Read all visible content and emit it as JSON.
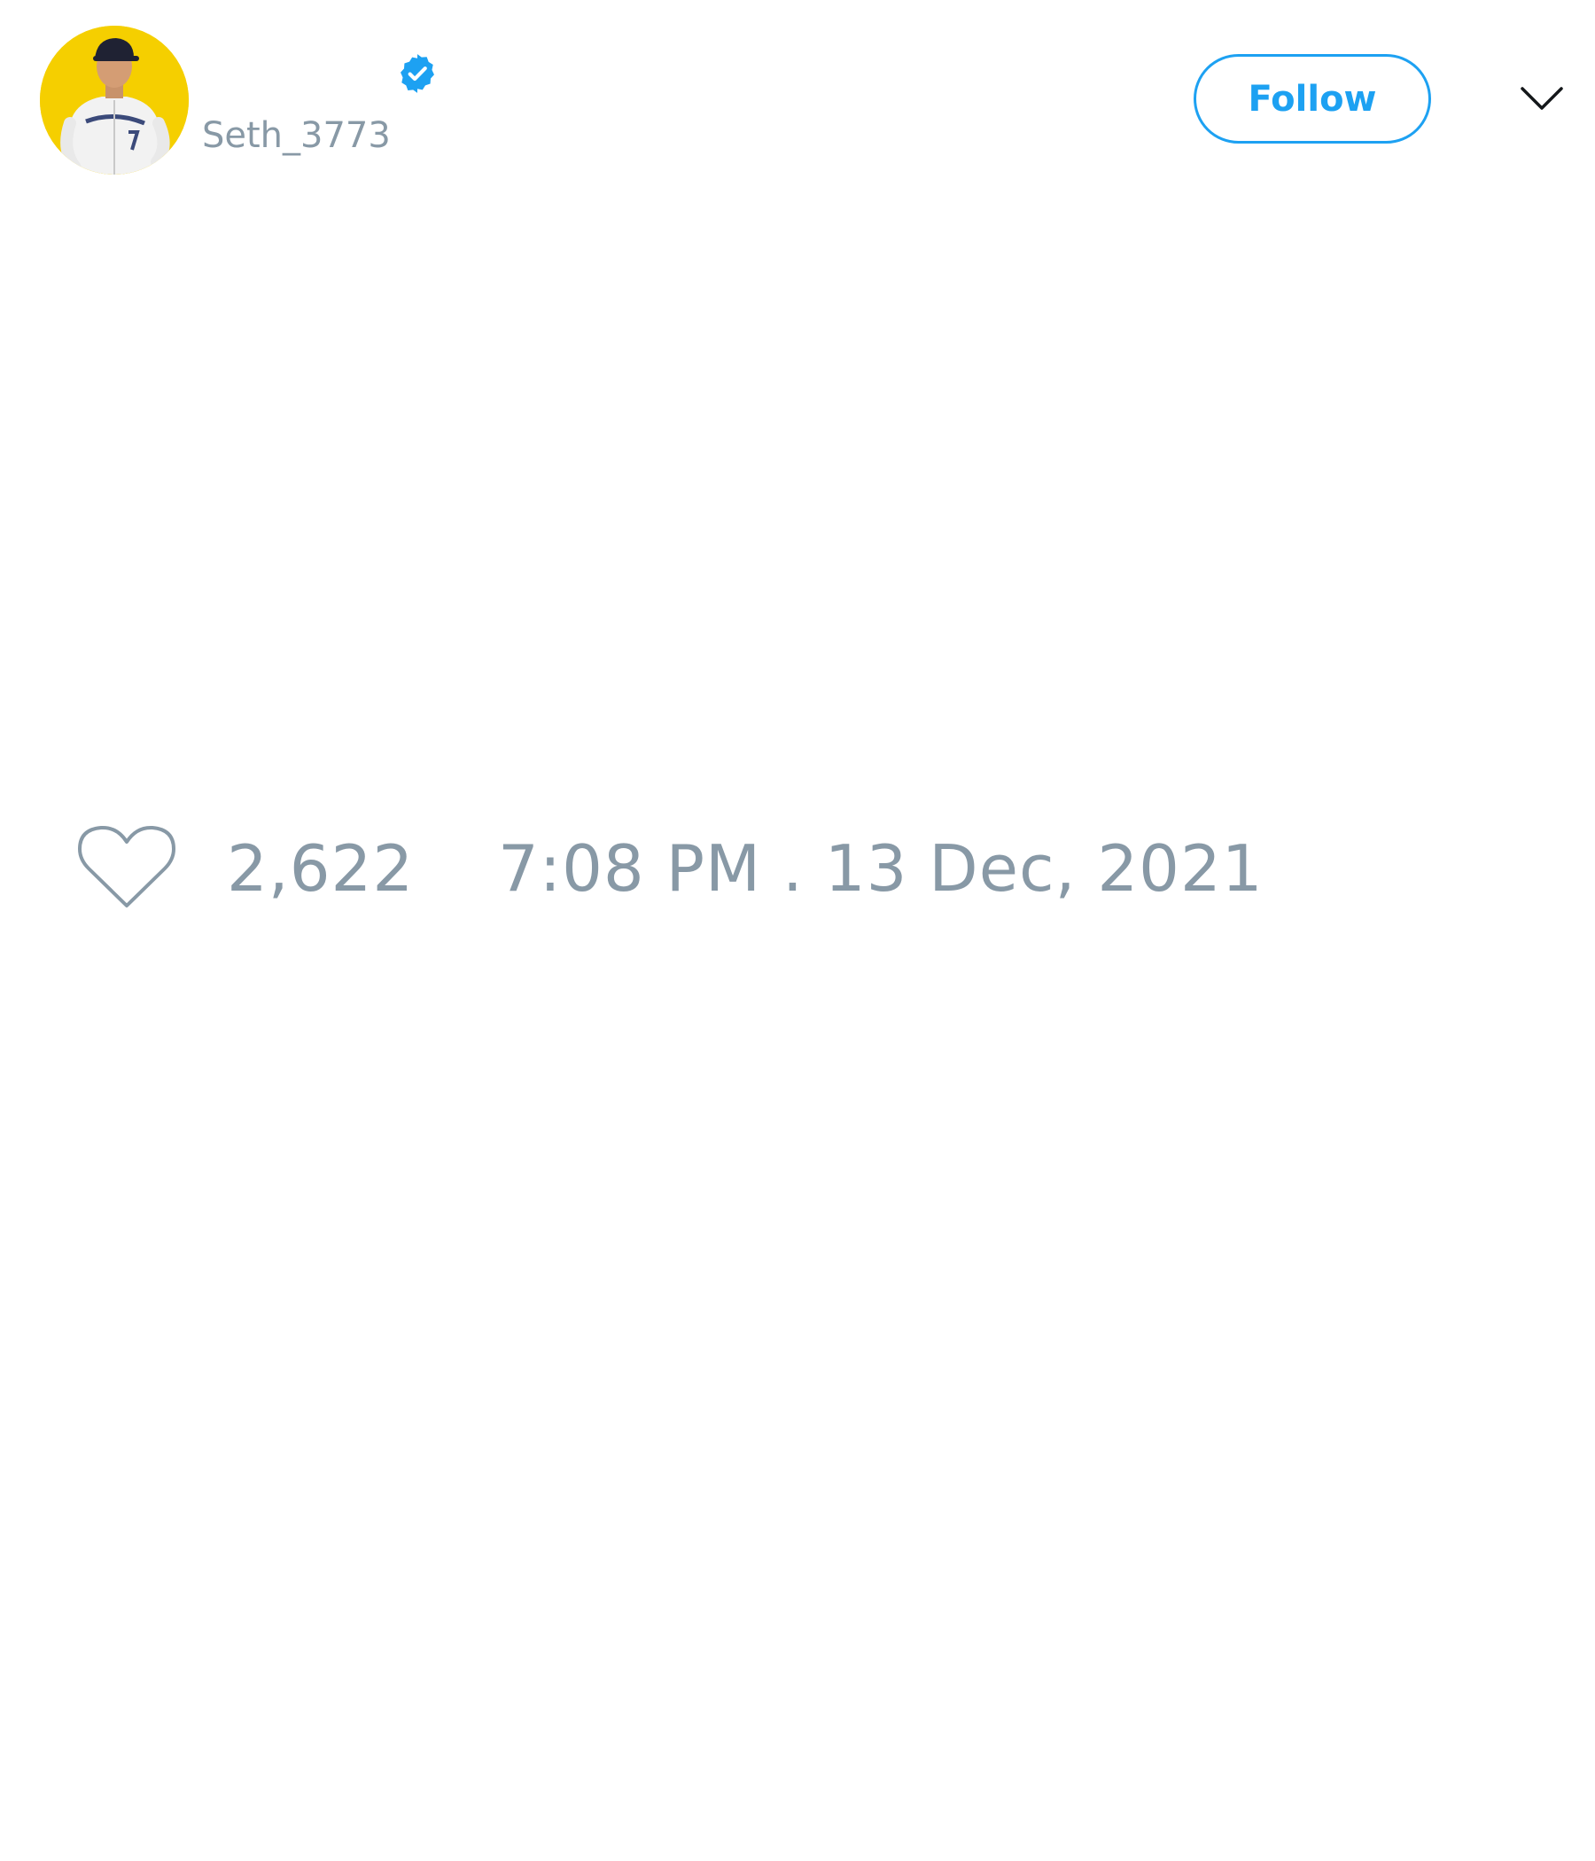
{
  "tweet": {
    "author": {
      "display_name": "",
      "username": "Seth_3773",
      "verified": true,
      "avatar_icon": "baseball-player-avatar",
      "verified_icon": "verified-badge-icon"
    },
    "header": {
      "follow_label": "Follow",
      "menu_icon": "chevron-down-icon"
    },
    "footer": {
      "like_icon": "heart-icon",
      "like_count": "2,622",
      "timestamp": "7:08 PM . 13 Dec, 2021"
    }
  },
  "colors": {
    "accent": "#1da1f2",
    "muted_text": "#8899a6",
    "avatar_background": "#f5cf00",
    "background": "#ffffff"
  }
}
